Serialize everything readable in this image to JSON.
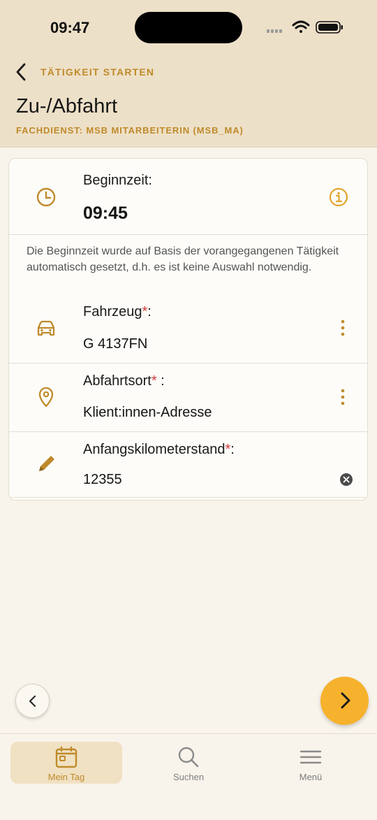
{
  "status_bar": {
    "time": "09:47"
  },
  "nav": {
    "back_label": "TÄTIGKEIT STARTEN"
  },
  "page": {
    "title": "Zu-/Abfahrt",
    "subtitle": "FACHDIENST: MSB MITARBEITERIN (MSB_MA)"
  },
  "form": {
    "start_time": {
      "label": "Beginnzeit:",
      "value": "09:45"
    },
    "note": "Die Beginnzeit wurde auf Basis der vorangegangenen Tätigkeit automatisch gesetzt, d.h. es ist keine Auswahl notwendig.",
    "vehicle": {
      "label": "Fahrzeug",
      "required_mark": "*",
      "suffix": ":",
      "value": "G 4137FN"
    },
    "departure": {
      "label": "Abfahrtsort",
      "required_mark": "*",
      "suffix": " :",
      "value": "Klient:innen-Adresse"
    },
    "odometer": {
      "label": "Anfangskilometerstand",
      "required_mark": "*",
      "suffix": ":",
      "value": "12355"
    }
  },
  "tabs": [
    {
      "label": "Mein Tag",
      "icon": "calendar-icon",
      "active": true
    },
    {
      "label": "Suchen",
      "icon": "search-icon",
      "active": false
    },
    {
      "label": "Menü",
      "icon": "menu-icon",
      "active": false
    }
  ],
  "colors": {
    "accent": "#bf8a2a",
    "header_bg": "#ede0c8",
    "page_bg": "#f8f4ec",
    "primary_button": "#f6b22d",
    "required": "#d23a3a"
  }
}
